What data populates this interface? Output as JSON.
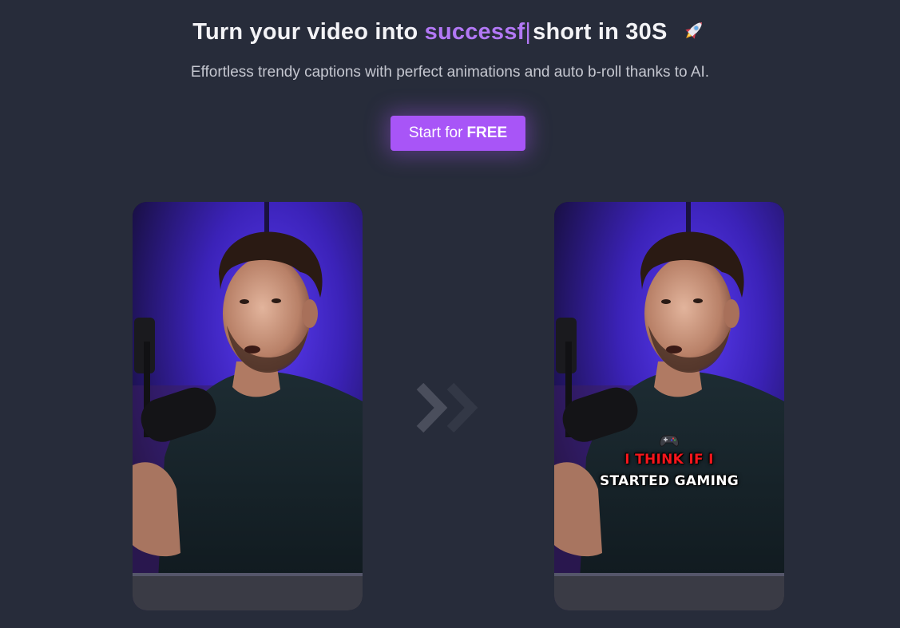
{
  "hero": {
    "title_prefix": "Turn your video into ",
    "title_accent": "successf",
    "title_caret": "|",
    "title_suffix": "short in 30S",
    "subtitle": "Effortless trendy captions with perfect animations and auto b-roll thanks to AI."
  },
  "cta": {
    "label_regular": "Start for",
    "label_bold": "FREE",
    "color": "#a855f7"
  },
  "demo": {
    "before_video": {
      "alt": "raw talking-head video"
    },
    "after_video": {
      "caption_line1": "I THINK IF I",
      "caption_line2": "STARTED GAMING",
      "caption_line1_color": "#f5161c",
      "caption_line2_color": "#ffffff",
      "emoji_icon": "game-controller-icon"
    },
    "arrows_icon": "double-chevron-right-icon"
  },
  "colors": {
    "background": "#272c3a",
    "accent": "#b278f5"
  }
}
